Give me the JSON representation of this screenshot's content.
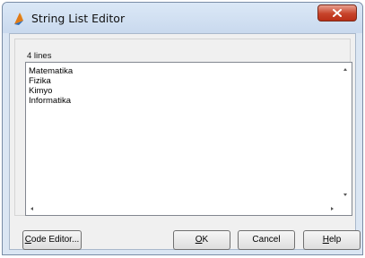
{
  "window": {
    "title": "String List Editor",
    "icon": "delphi-app-icon",
    "close_icon": "close-x-icon"
  },
  "editor": {
    "line_count": "4 lines",
    "lines": [
      "Matematika",
      "Fizika",
      "Kimyo",
      "Informatika"
    ]
  },
  "buttons": {
    "code_editor": {
      "underlined": "C",
      "rest": "ode Editor..."
    },
    "ok": {
      "underlined": "O",
      "rest": "K"
    },
    "cancel": {
      "label": "Cancel"
    },
    "help": {
      "underlined": "H",
      "rest": "elp"
    }
  }
}
